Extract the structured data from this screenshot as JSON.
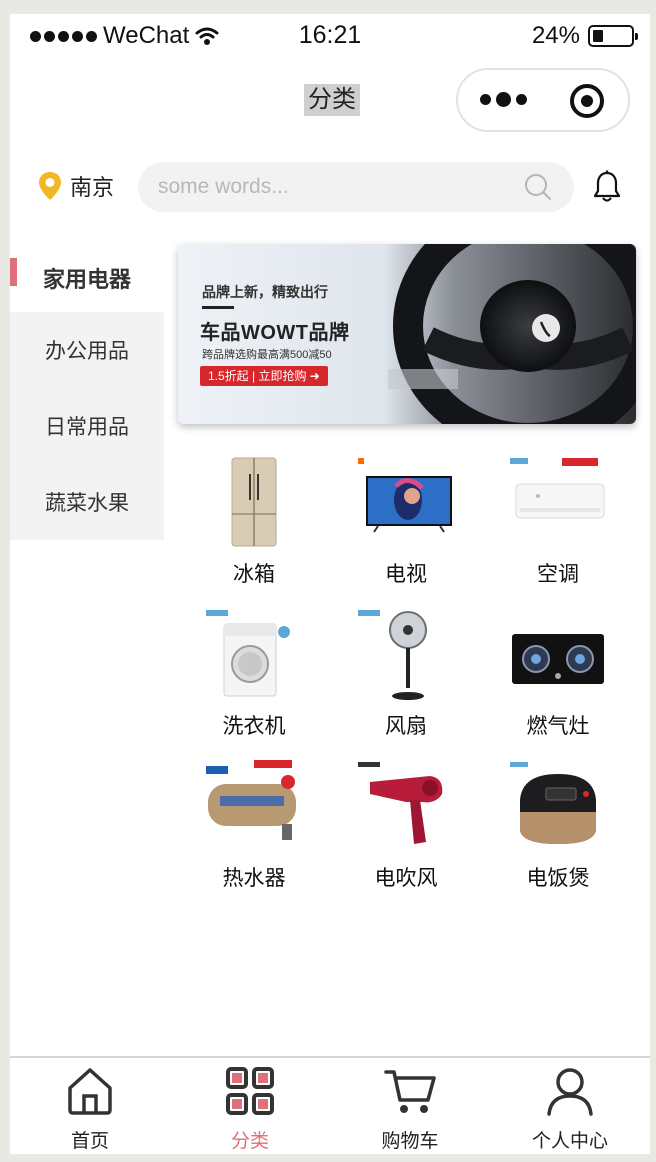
{
  "status_bar": {
    "carrier": "WeChat",
    "time": "16:21",
    "battery": "24%"
  },
  "navbar": {
    "title": "分类"
  },
  "search_row": {
    "city": "南京",
    "placeholder": "some words..."
  },
  "sidebar": {
    "items": [
      {
        "label": "家用电器",
        "active": true
      },
      {
        "label": "办公用品",
        "active": false
      },
      {
        "label": "日常用品",
        "active": false
      },
      {
        "label": "蔬菜水果",
        "active": false
      }
    ]
  },
  "banner": {
    "line1": "品牌上新，精致出行",
    "line2": "车品WOWT品牌",
    "line3": "跨品牌选购最高满500减50",
    "tag": "1.5折起 | 立即抢购"
  },
  "products": [
    {
      "label": "冰箱"
    },
    {
      "label": "电视"
    },
    {
      "label": "空调"
    },
    {
      "label": "洗衣机"
    },
    {
      "label": "风扇"
    },
    {
      "label": "燃气灶"
    },
    {
      "label": "热水器"
    },
    {
      "label": "电吹风"
    },
    {
      "label": "电饭煲"
    }
  ],
  "tabbar": {
    "items": [
      {
        "label": "首页",
        "icon": "home-icon"
      },
      {
        "label": "分类",
        "icon": "category-icon",
        "active": true
      },
      {
        "label": "购物车",
        "icon": "cart-icon"
      },
      {
        "label": "个人中心",
        "icon": "user-icon"
      }
    ]
  },
  "colors": {
    "accent": "#e0717c",
    "location_pin": "#f2b824",
    "banner_tag": "#d8262d"
  }
}
